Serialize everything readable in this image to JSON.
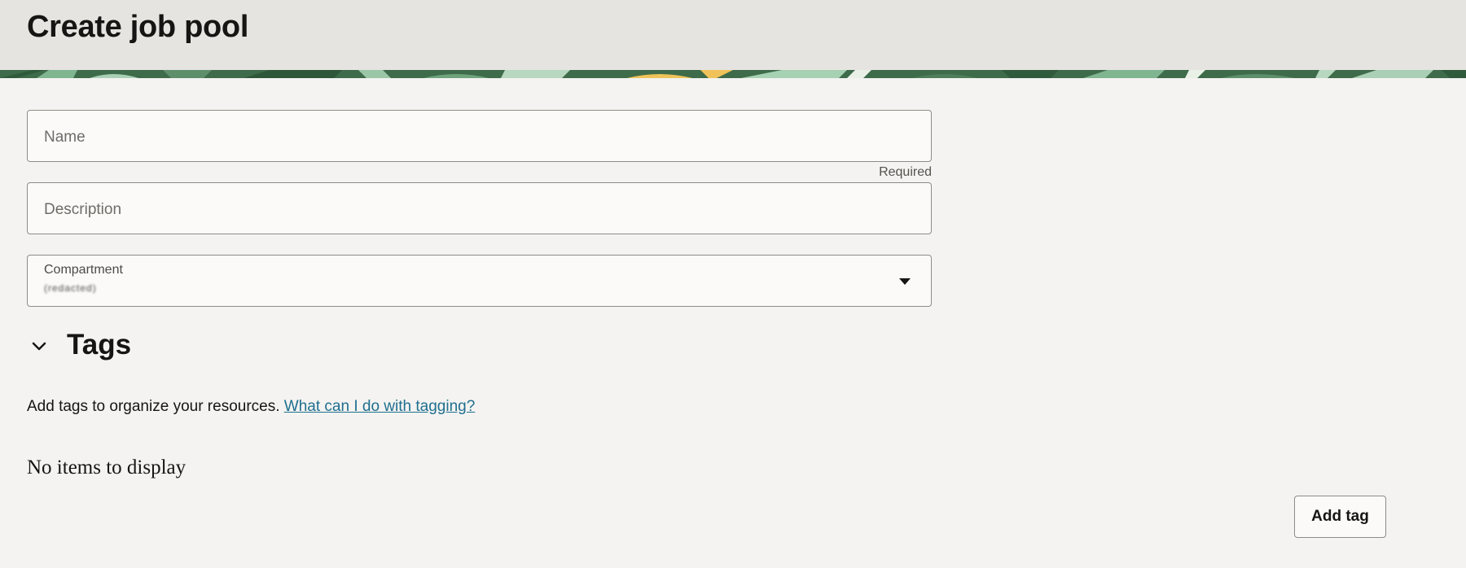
{
  "page": {
    "title": "Create job pool"
  },
  "form": {
    "name": {
      "placeholder": "Name",
      "value": "",
      "hint": "Required"
    },
    "description": {
      "placeholder": "Description",
      "value": ""
    },
    "compartment": {
      "label": "Compartment",
      "value": "(redacted)"
    }
  },
  "tags": {
    "title": "Tags",
    "description": "Add tags to organize your resources.",
    "help_link": "What can I do with tagging?",
    "empty_text": "No items to display",
    "add_button": "Add tag"
  },
  "icons": {
    "tags_toggle": "chevron-down-icon",
    "compartment_dropdown": "caret-down-icon"
  },
  "colors": {
    "header_bg": "#e5e4e1",
    "page_bg": "#f4f3f1",
    "link": "#1f6f8f",
    "banner_green": "#3e6b4a"
  }
}
